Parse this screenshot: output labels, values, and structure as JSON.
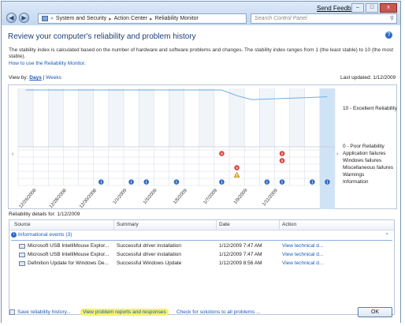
{
  "titlebar": {
    "breadcrumb": [
      "System and Security",
      "Action Center",
      "Reliability Monitor"
    ],
    "search_placeholder": "Search Control Panel",
    "feedback_label": "Send Feedback",
    "back_glyph": "◀",
    "forward_glyph": "▶",
    "minimize_glyph": "–",
    "maximize_glyph": "□",
    "close_glyph": "x"
  },
  "page": {
    "title": "Review your computer's reliability and problem history",
    "description": "The stability index is calculated based on the number of hardware and software problems and changes. The stability index ranges from 1 (the least stable) to 10 (the most stable).",
    "howto_link": "How to use the Reliability Monitor.",
    "viewby_label": "View by:",
    "viewby_days": "Days",
    "viewby_sep": "|",
    "viewby_weeks": "Weeks",
    "last_updated": "Last updated: 1/12/2009"
  },
  "chart_data": {
    "type": "line",
    "ylabel_top": "10 - Excellent Reliability",
    "ylabel_bottom": "0 - Poor Reliability",
    "x_tick_labels": [
      "12/26/2008",
      "12/28/2008",
      "12/30/2008",
      "1/1/2009",
      "1/3/2009",
      "1/5/2009",
      "1/7/2009",
      "1/9/2009",
      "1/11/2009"
    ],
    "categories": [
      "Application failures",
      "Windows failures",
      "Miscellaneous failures",
      "Warnings",
      "Information"
    ],
    "stability_index": {
      "ylim": [
        0,
        10
      ],
      "values": [
        10,
        10,
        10,
        10,
        10,
        10,
        10,
        10,
        10,
        10,
        10,
        10,
        10,
        10,
        9,
        8.3,
        8.4,
        8.5,
        8.6,
        8.7,
        8.8
      ]
    },
    "events": [
      {
        "category": "Application failures",
        "day_index": [
          13,
          17
        ]
      },
      {
        "category": "Windows failures",
        "day_index": [
          17
        ]
      },
      {
        "category": "Miscellaneous failures",
        "day_index": [
          14
        ]
      },
      {
        "category": "Warnings",
        "day_index": [
          14
        ]
      },
      {
        "category": "Information",
        "day_index": [
          5,
          7,
          8,
          10,
          13,
          16,
          17,
          19,
          20
        ]
      }
    ],
    "selected_day": "1/12/2009",
    "grid": true
  },
  "details": {
    "label": "Reliability details for: 1/12/2009",
    "columns": [
      "Source",
      "Summary",
      "Date",
      "Action"
    ],
    "group_label": "Informational events (3)",
    "rows": [
      {
        "source": "Microsoft USB IntelliMouse Explor...",
        "summary": "Successful driver installation",
        "date": "1/12/2009 7:47 AM",
        "action": "View  technical d..."
      },
      {
        "source": "Microsoft USB IntelliMouse Explor...",
        "summary": "Successful driver installation",
        "date": "1/12/2009 7:47 AM",
        "action": "View  technical d..."
      },
      {
        "source": "Definition Update for Windows De...",
        "summary": "Successful Windows Update",
        "date": "1/12/2009 8:56 AM",
        "action": "View  technical d..."
      }
    ]
  },
  "footer": {
    "save_link": "Save reliability history...",
    "view_reports_link": "View problem reports and responses",
    "check_solutions_link": "Check for solutions to all problems ...",
    "ok_label": "OK"
  },
  "colors": {
    "accent": "#1a5bb7",
    "highlight": "#f5f36a",
    "line": "#6aaee8",
    "selected_col": "#cfe3f7"
  }
}
